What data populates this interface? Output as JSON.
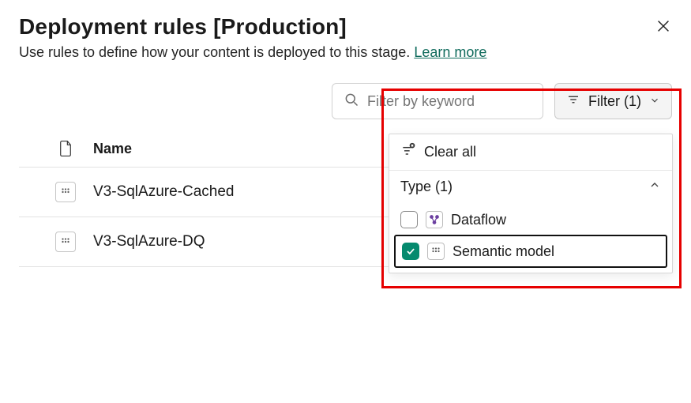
{
  "header": {
    "title": "Deployment rules [Production]",
    "subtitle": "Use rules to define how your content is deployed to this stage.",
    "learn_more": "Learn more"
  },
  "toolbar": {
    "search_placeholder": "Filter by keyword",
    "filter_label": "Filter (1)"
  },
  "filter_dropdown": {
    "clear_all": "Clear all",
    "type_header": "Type (1)",
    "options": [
      {
        "label": "Dataflow",
        "checked": false
      },
      {
        "label": "Semantic model",
        "checked": true
      }
    ]
  },
  "table": {
    "header_name": "Name",
    "rows": [
      {
        "name": "V3-SqlAzure-Cached"
      },
      {
        "name": "V3-SqlAzure-DQ"
      }
    ]
  },
  "colors": {
    "accent_green": "#058a6e",
    "link_teal": "#0f6b5c",
    "highlight_red": "#e60000"
  }
}
